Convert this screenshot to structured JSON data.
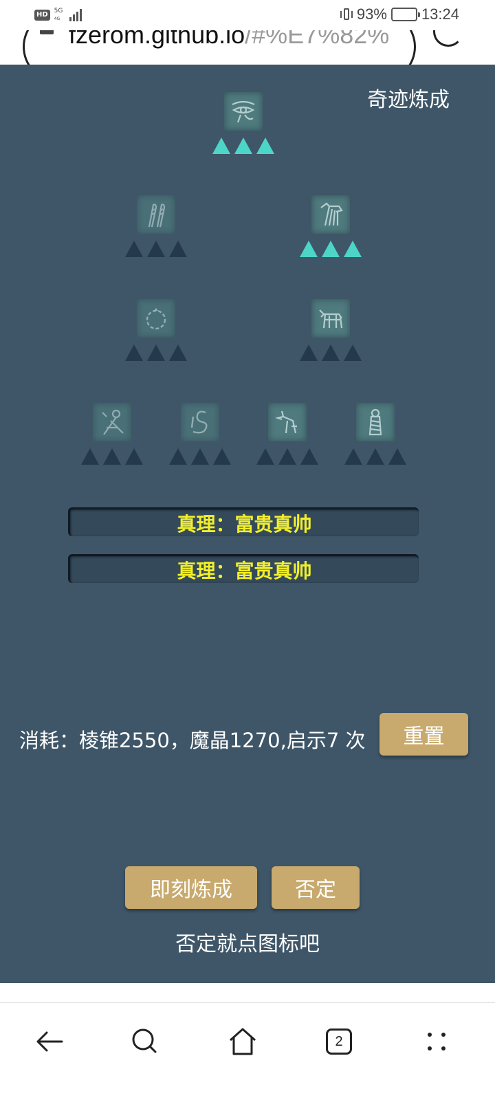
{
  "status": {
    "hd": "HD",
    "network": "5G",
    "network_sub": "4G",
    "battery_pct": "93%",
    "time": "13:24"
  },
  "browser": {
    "url_visible": "fzerom.github.io",
    "url_dim": "/#%E7%82%"
  },
  "game": {
    "title": "奇迹炼成",
    "nodes": [
      {
        "icon": "eye-of-horus-icon",
        "lit": 3
      },
      {
        "icon": "feathers-icon",
        "lit": 0
      },
      {
        "icon": "jackal-head-icon",
        "lit": 3
      },
      {
        "icon": "ring-icon",
        "lit": 0
      },
      {
        "icon": "bull-icon",
        "lit": 0
      },
      {
        "icon": "staff-icon",
        "lit": 0
      },
      {
        "icon": "serpent-icon",
        "lit": 0
      },
      {
        "icon": "anubis-icon",
        "lit": 0
      },
      {
        "icon": "mummy-icon",
        "lit": 0
      }
    ],
    "truths": [
      "真理：富贵真帅",
      "真理：富贵真帅"
    ],
    "cost_text": "消耗：棱锥2550，魔晶1270,启示7 次",
    "reset_label": "重置",
    "craft_label": "即刻炼成",
    "deny_label": "否定",
    "hint": "否定就点图标吧"
  },
  "nav": {
    "back_icon": "back-arrow-icon",
    "search_icon": "search-icon",
    "home_icon": "home-icon",
    "tabs_count": "2",
    "menu_icon": "more-icon"
  },
  "colors": {
    "game_bg": "#3e5668",
    "triangle_on": "#4dd6c8",
    "triangle_off": "#243a4c",
    "truth_text": "#f2ef2a",
    "button": "#c8aa6e"
  }
}
